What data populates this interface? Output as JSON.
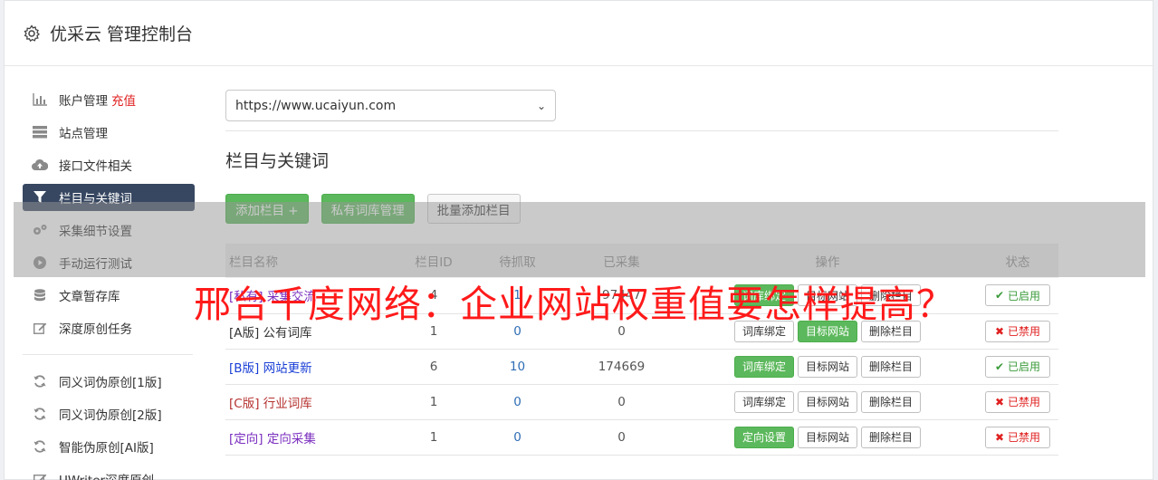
{
  "header": {
    "title": "优采云 管理控制台",
    "icon": "gear-icon"
  },
  "sidebar": {
    "group1": [
      {
        "label": "账户管理",
        "extra": "充值",
        "icon": "bar-chart-icon"
      },
      {
        "label": "站点管理",
        "icon": "server-icon"
      },
      {
        "label": "接口文件相关",
        "icon": "cloud-upload-icon"
      },
      {
        "label": "栏目与关键词",
        "icon": "filter-icon",
        "active": true
      },
      {
        "label": "采集细节设置",
        "icon": "cogs-icon"
      },
      {
        "label": "手动运行测试",
        "icon": "play-circle-icon"
      },
      {
        "label": "文章暂存库",
        "icon": "database-icon"
      },
      {
        "label": "深度原创任务",
        "icon": "edit-icon"
      }
    ],
    "group2": [
      {
        "label": "同义词伪原创[1版]",
        "icon": "refresh-icon"
      },
      {
        "label": "同义词伪原创[2版]",
        "icon": "refresh-icon"
      },
      {
        "label": "智能伪原创[AI版]",
        "icon": "refresh-icon"
      },
      {
        "label": "UWriter深度原创",
        "icon": "edit-icon"
      }
    ]
  },
  "site_select": {
    "value": "https://www.ucaiyun.com"
  },
  "section_title": "栏目与关键词",
  "toolbar": {
    "add": "添加栏目 +",
    "private_lib": "私有词库管理",
    "batch_add": "批量添加栏目"
  },
  "table": {
    "headers": [
      "栏目名称",
      "栏目ID",
      "待抓取",
      "已采集",
      "操作",
      "状态"
    ],
    "rows": [
      {
        "name": "[私有] 采集交流",
        "name_color": "#7b2fbf",
        "id": "4",
        "pending": "1",
        "collected": "97447",
        "op1": "词库绑定",
        "op1_active": true,
        "op2": "目标网站",
        "op2_active": false,
        "op3": "删除栏目",
        "status": "已启用",
        "status_on": true
      },
      {
        "name": "[A版] 公有词库",
        "name_color": "#333333",
        "id": "1",
        "pending": "0",
        "collected": "0",
        "op1": "词库绑定",
        "op1_active": false,
        "op2": "目标网站",
        "op2_active": true,
        "op3": "删除栏目",
        "status": "已禁用",
        "status_on": false
      },
      {
        "name": "[B版] 网站更新",
        "name_color": "#1a3fd6",
        "id": "6",
        "pending": "10",
        "collected": "174669",
        "op1": "词库绑定",
        "op1_active": true,
        "op2": "目标网站",
        "op2_active": false,
        "op3": "删除栏目",
        "status": "已启用",
        "status_on": true
      },
      {
        "name": "[C版] 行业词库",
        "name_color": "#b5322f",
        "id": "1",
        "pending": "0",
        "collected": "0",
        "op1": "词库绑定",
        "op1_active": false,
        "op2": "目标网站",
        "op2_active": false,
        "op3": "删除栏目",
        "status": "已禁用",
        "status_on": false
      },
      {
        "name": "[定向] 定向采集",
        "name_color": "#7b2fbf",
        "id": "1",
        "pending": "0",
        "collected": "0",
        "op1": "定向设置",
        "op1_active": true,
        "op2": "目标网站",
        "op2_active": false,
        "op3": "删除栏目",
        "status": "已禁用",
        "status_on": false
      }
    ]
  },
  "overlay_headline": "邢台千度网络：企业网站权重值要怎样提高？",
  "colors": {
    "accent_nav": "#374761",
    "green": "#5cb85c",
    "red_text": "#e02020",
    "headline_red": "#ff1a1a"
  }
}
